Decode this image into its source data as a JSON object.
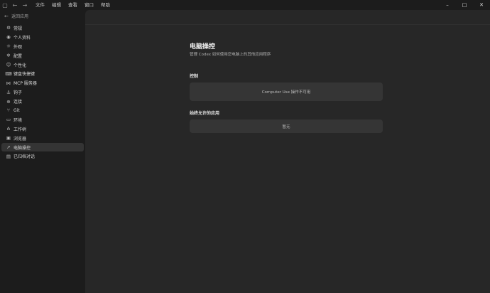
{
  "titlebar": {
    "menus": [
      "文件",
      "编辑",
      "查看",
      "窗口",
      "帮助"
    ]
  },
  "sidebar": {
    "back_label": "返回应用",
    "items": [
      {
        "label": "常规",
        "icon": "gear-icon"
      },
      {
        "label": "个人资料",
        "icon": "user-icon"
      },
      {
        "label": "外观",
        "icon": "sun-icon"
      },
      {
        "label": "配置",
        "icon": "settings-icon"
      },
      {
        "label": "个性化",
        "icon": "person-icon"
      },
      {
        "label": "键盘快捷键",
        "icon": "keyboard-icon"
      },
      {
        "label": "MCP 服务器",
        "icon": "server-icon"
      },
      {
        "label": "钩子",
        "icon": "hook-icon"
      },
      {
        "label": "连接",
        "icon": "globe-icon"
      },
      {
        "label": "Git",
        "icon": "git-icon"
      },
      {
        "label": "环境",
        "icon": "monitor-icon"
      },
      {
        "label": "工作树",
        "icon": "tree-icon"
      },
      {
        "label": "浏览器",
        "icon": "browser-icon"
      },
      {
        "label": "电脑操控",
        "icon": "cursor-icon",
        "active": true
      },
      {
        "label": "已归档对话",
        "icon": "archive-icon"
      }
    ]
  },
  "main": {
    "title": "电脑操控",
    "subtitle": "管理 Codex 如何使用您电脑上的其他应用程序",
    "control_label": "控制",
    "control_status": "Computer Use 操作不可用",
    "allowed_label": "始终允许的应用",
    "allowed_empty": "暂无"
  }
}
